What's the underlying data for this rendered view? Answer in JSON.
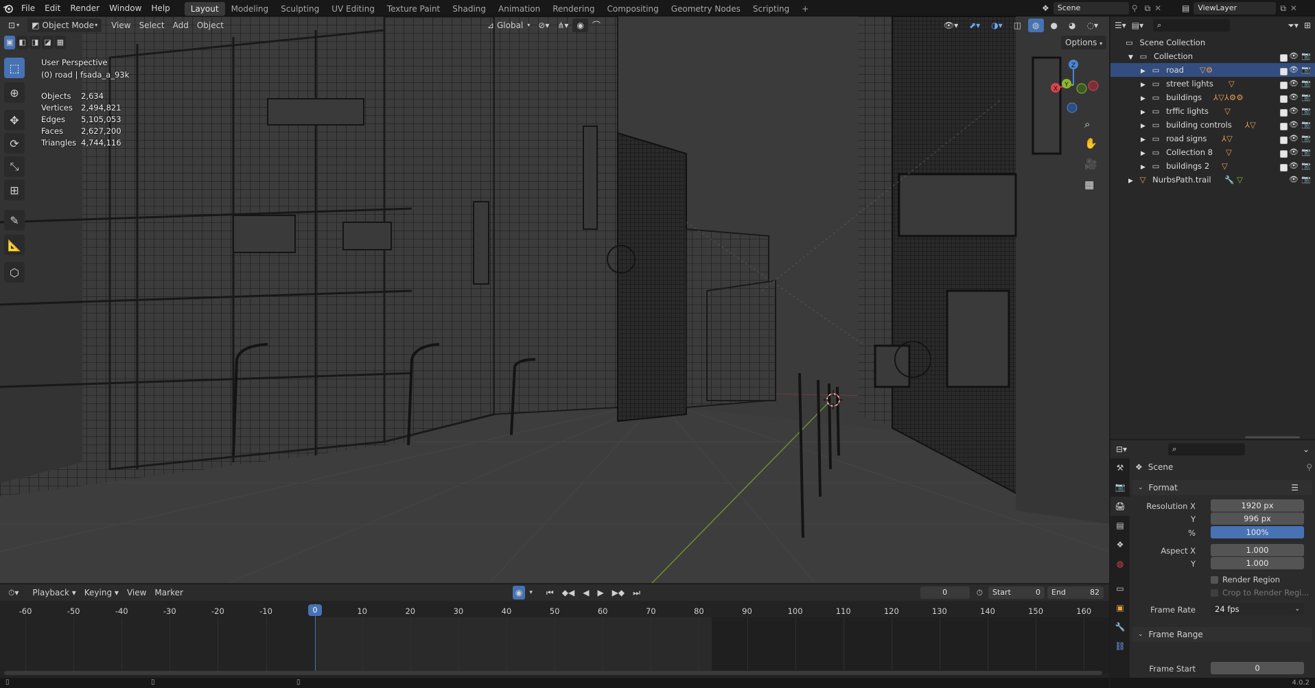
{
  "topbar": {
    "menus": [
      "File",
      "Edit",
      "Render",
      "Window",
      "Help"
    ],
    "workspaces": [
      "Layout",
      "Modeling",
      "Sculpting",
      "UV Editing",
      "Texture Paint",
      "Shading",
      "Animation",
      "Rendering",
      "Compositing",
      "Geometry Nodes",
      "Scripting"
    ],
    "active_workspace": "Layout",
    "add_tab": "+",
    "scene": "Scene",
    "view_layer": "ViewLayer"
  },
  "viewport": {
    "mode": "Object Mode",
    "menus": [
      "View",
      "Select",
      "Add",
      "Object"
    ],
    "transform": "Global",
    "options": "Options",
    "overlay_title": "User Perspective",
    "overlay_subtitle": "(0) road | fsada_a_93k",
    "stats": [
      {
        "label": "Objects",
        "value": "2,634"
      },
      {
        "label": "Vertices",
        "value": "2,494,821"
      },
      {
        "label": "Edges",
        "value": "5,105,053"
      },
      {
        "label": "Faces",
        "value": "2,627,200"
      },
      {
        "label": "Triangles",
        "value": "4,744,116"
      }
    ],
    "gizmo": {
      "x": "X",
      "y": "Y",
      "z": "Z"
    }
  },
  "outliner": {
    "scene_collection": "Scene Collection",
    "collection": "Collection",
    "items": [
      {
        "name": "road",
        "selected": true
      },
      {
        "name": "street lights",
        "selected": false
      },
      {
        "name": "buildings",
        "selected": false
      },
      {
        "name": "trffic lights",
        "selected": false
      },
      {
        "name": "building controls",
        "selected": false
      },
      {
        "name": "road signs",
        "selected": false
      },
      {
        "name": "Collection 8",
        "selected": false
      },
      {
        "name": "buildings 2",
        "selected": false
      }
    ],
    "extra": "NurbsPath.trail"
  },
  "properties": {
    "context": "Scene",
    "format_panel": "Format",
    "resolution_x_label": "Resolution X",
    "resolution_x": "1920 px",
    "y_label": "Y",
    "resolution_y": "996 px",
    "percent_label": "%",
    "percent": "100%",
    "aspect_x_label": "Aspect X",
    "aspect_x": "1.000",
    "aspect_y_label": "Y",
    "aspect_y": "1.000",
    "render_region": "Render Region",
    "crop_region": "Crop to Render Regi...",
    "frame_rate_label": "Frame Rate",
    "frame_rate": "24 fps",
    "frame_range_panel": "Frame Range",
    "frame_start_label": "Frame Start",
    "frame_start": "0"
  },
  "timeline": {
    "menus": [
      "Playback",
      "Keying",
      "View",
      "Marker"
    ],
    "current_frame": "0",
    "start_label": "Start",
    "start": "0",
    "end_label": "End",
    "end": "82",
    "ticks": [
      "-60",
      "-50",
      "-40",
      "-30",
      "-20",
      "-10",
      "0",
      "10",
      "20",
      "30",
      "40",
      "50",
      "60",
      "70",
      "80",
      "90",
      "100",
      "110",
      "120",
      "130",
      "140",
      "150",
      "160"
    ],
    "playhead": "0"
  },
  "version": "4.0.2",
  "colors": {
    "accent": "#4772b3",
    "selected_row": "#334d80",
    "axis_x": "#d9434d",
    "axis_y": "#8ab830",
    "axis_z": "#4a86d6"
  }
}
